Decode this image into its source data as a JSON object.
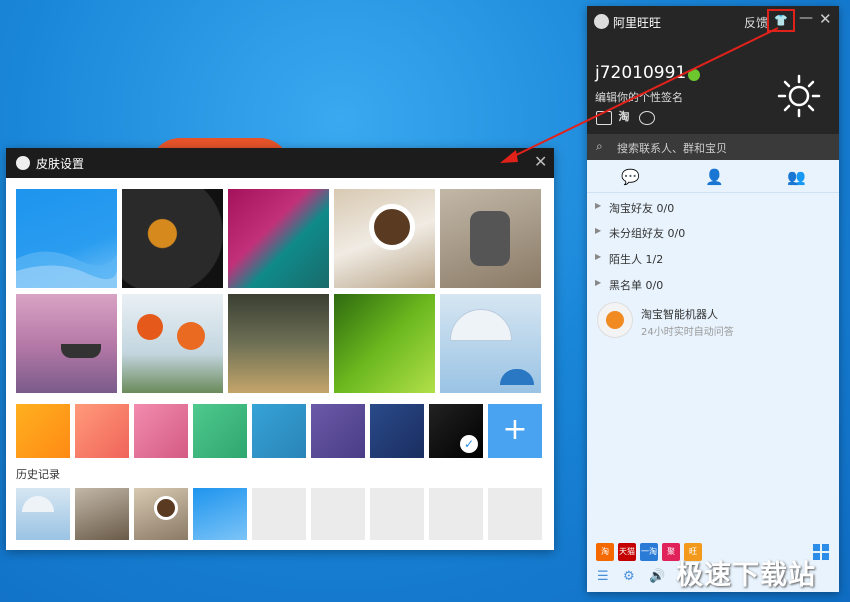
{
  "skin_dialog": {
    "title": "皮肤设置",
    "close_glyph": "✕",
    "history_label": "历史记录",
    "plus_glyph": "+",
    "check_glyph": "✓"
  },
  "wangwang": {
    "title": "阿里旺旺",
    "feedback": "反馈",
    "shirt_glyph": "👕",
    "minimize_glyph": "—",
    "close_glyph": "✕",
    "username": "j72010991",
    "signature": "编辑你的个性签名",
    "search_placeholder": "搜索联系人、群和宝贝",
    "groups": [
      {
        "label": "淘宝好友 0/0"
      },
      {
        "label": "未分组好友 0/0"
      },
      {
        "label": "陌生人 1/2"
      },
      {
        "label": "黑名单 0/0"
      }
    ],
    "robot": {
      "name": "淘宝智能机器人",
      "desc": "24小时实时自动问答"
    },
    "apps": [
      {
        "label": "淘",
        "color": "#f56a00"
      },
      {
        "label": "天猫",
        "color": "#c40000"
      },
      {
        "label": "一淘",
        "color": "#2a7bd6"
      },
      {
        "label": "聚",
        "color": "#e0215a"
      },
      {
        "label": "旺",
        "color": "#f39a1e"
      }
    ],
    "status_color": "#6cc82e"
  },
  "watermark": "极速下载站"
}
